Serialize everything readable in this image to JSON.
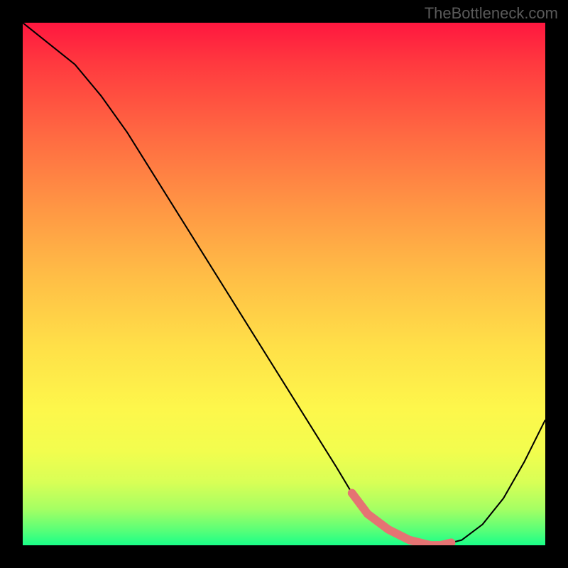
{
  "watermark": "TheBottleneck.com",
  "chart_data": {
    "type": "line",
    "title": "",
    "xlabel": "",
    "ylabel": "",
    "xlim": [
      0,
      100
    ],
    "ylim": [
      0,
      100
    ],
    "series": [
      {
        "name": "bottleneck-curve",
        "x": [
          0,
          5,
          10,
          15,
          20,
          25,
          30,
          35,
          40,
          45,
          50,
          55,
          60,
          63,
          66,
          70,
          74,
          78,
          80,
          84,
          88,
          92,
          96,
          100
        ],
        "y": [
          100,
          96,
          92,
          86,
          79,
          71,
          63,
          55,
          47,
          39,
          31,
          23,
          15,
          10,
          6,
          3,
          1,
          0,
          0,
          1,
          4,
          9,
          16,
          24
        ]
      }
    ],
    "highlight_marker": {
      "name": "flat-bottom-marker",
      "color": "#e57373",
      "x": [
        63,
        66,
        70,
        74,
        78,
        80,
        82
      ],
      "y": [
        10,
        6,
        3,
        1,
        0,
        0,
        0.5
      ]
    },
    "background": {
      "type": "vertical-gradient",
      "stops": [
        {
          "pos": 0,
          "color": "#ff173f"
        },
        {
          "pos": 50,
          "color": "#ffcc46"
        },
        {
          "pos": 80,
          "color": "#fdf74b"
        },
        {
          "pos": 100,
          "color": "#1aff88"
        }
      ]
    }
  }
}
